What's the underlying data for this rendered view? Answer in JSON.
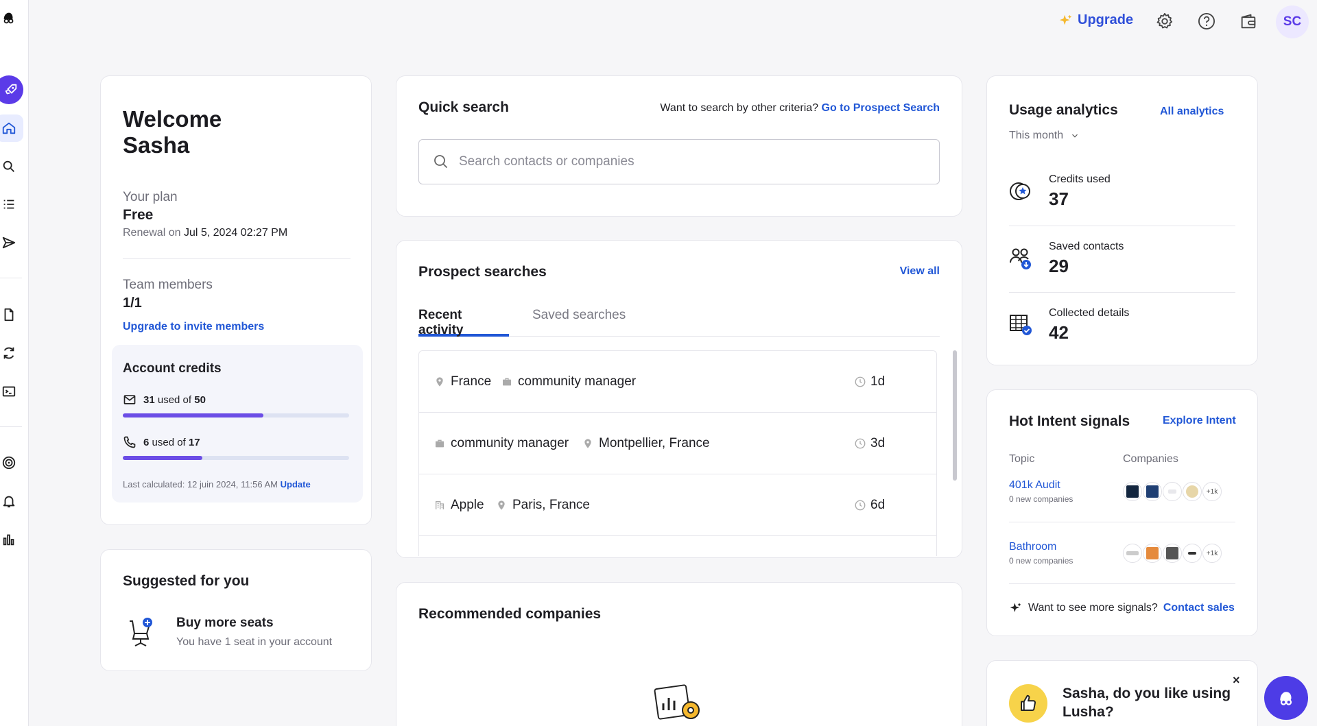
{
  "topbar": {
    "upgrade_label": "Upgrade",
    "avatar_initials": "SC"
  },
  "welcome": {
    "title_line1": "Welcome",
    "title_line2": "Sasha",
    "plan_label": "Your plan",
    "plan_value": "Free",
    "renewal_label": "Renewal on",
    "renewal_date": "Jul 5, 2024 02:27 PM",
    "team_label": "Team members",
    "team_value": "1/1",
    "team_link": "Upgrade to invite members"
  },
  "credits": {
    "title": "Account credits",
    "email": {
      "used": "31",
      "used_text": "used of",
      "total": "50",
      "fraction": 0.62
    },
    "phone": {
      "used": "6",
      "used_text": "used of",
      "total": "17",
      "fraction": 0.35
    },
    "last_calc": "Last calculated: 12 juin 2024, 11:56 AM",
    "update_link": "Update"
  },
  "suggested": {
    "title": "Suggested for you",
    "item_title": "Buy more seats",
    "item_sub": "You have 1 seat in your account"
  },
  "quick_search": {
    "title": "Quick search",
    "hint": "Want to search by other criteria?",
    "hint_link": "Go to Prospect Search",
    "placeholder": "Search contacts or companies"
  },
  "prospect": {
    "title": "Prospect searches",
    "view_all": "View all",
    "tab_recent": "Recent activity",
    "tab_saved": "Saved searches",
    "rows": [
      {
        "chip1": "France",
        "chip2": "community manager",
        "time": "1d"
      },
      {
        "chip1": "community manager",
        "chip2": "Montpellier, France",
        "time": "3d"
      },
      {
        "chip1": "Apple",
        "chip2": "Paris, France",
        "time": "6d"
      }
    ]
  },
  "recommended": {
    "title": "Recommended companies"
  },
  "usage": {
    "title": "Usage analytics",
    "all_link": "All analytics",
    "period": "This month",
    "items": [
      {
        "label": "Credits used",
        "value": "37"
      },
      {
        "label": "Saved contacts",
        "value": "29"
      },
      {
        "label": "Collected details",
        "value": "42"
      }
    ]
  },
  "intent": {
    "title": "Hot Intent signals",
    "explore": "Explore Intent",
    "col_topic": "Topic",
    "col_companies": "Companies",
    "topics": [
      {
        "name": "401k Audit",
        "sub": "0 new companies",
        "more": "+1k"
      },
      {
        "name": "Bathroom",
        "sub": "0 new companies",
        "more": "+1k"
      }
    ],
    "footer_text": "Want to see more signals?",
    "footer_link": "Contact sales"
  },
  "feedback": {
    "text": "Sasha, do you like using Lusha?",
    "close": "×"
  },
  "colors": {
    "accent": "#2157d6",
    "brand": "#5b3be8",
    "progress": "#6b4de6"
  }
}
